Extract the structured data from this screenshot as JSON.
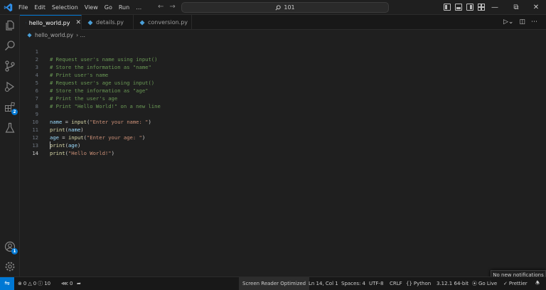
{
  "window": {
    "menu": [
      "File",
      "Edit",
      "Selection",
      "View",
      "Go",
      "Run",
      "…"
    ],
    "search_text": "101",
    "icons": [
      "vscode-logo",
      "back-arrow",
      "forward-arrow",
      "search-icon",
      "layout-icons",
      "minimize",
      "restore",
      "close"
    ]
  },
  "tabs": [
    {
      "label": "hello_world.py",
      "active": true
    },
    {
      "label": "details.py",
      "active": false
    },
    {
      "label": "conversion.py",
      "active": false
    }
  ],
  "breadcrumb": {
    "file": "hello_world.py",
    "more": "› …"
  },
  "activity": {
    "extensions_badge": "2",
    "accounts_badge": "1"
  },
  "editor": {
    "lines": [
      {
        "n": "1",
        "c": "# Request user's name using input()"
      },
      {
        "n": "2",
        "c": "# Store the information as \"name\""
      },
      {
        "n": "3",
        "c": "# Print user's name"
      },
      {
        "n": "4",
        "c": "# Request user's age using input()"
      },
      {
        "n": "5",
        "c": "# Store the information as \"age\""
      },
      {
        "n": "6",
        "c": "# Print the user's age"
      },
      {
        "n": "7",
        "c": "# Print \"Hello World!\" on a new line"
      },
      {
        "n": "8",
        "c": ""
      },
      {
        "n": "9",
        "var": "name",
        "eq": " = ",
        "fn": "input",
        "open": "(",
        "str": "\"Enter your name: \"",
        "close": ")"
      },
      {
        "n": "10",
        "fn": "print",
        "open": "(",
        "var": "name",
        "close": ")"
      },
      {
        "n": "11",
        "var": "age",
        "eq": " = ",
        "fn": "input",
        "open": "(",
        "str": "\"Enter your age: \"",
        "close": ")"
      },
      {
        "n": "12",
        "fn": "print",
        "open": "(",
        "var": "age",
        "close": ")"
      },
      {
        "n": "13",
        "fn": "print",
        "open": "(",
        "str": "\"Hello World!\"",
        "close": ")"
      },
      {
        "n": "14",
        "c": ""
      }
    ]
  },
  "notification": "No new notifications",
  "statusbar": {
    "errors": "0",
    "warnings": "0",
    "info": "10",
    "ports": "0",
    "screen_reader": "Screen Reader Optimized",
    "position": "Ln 14, Col 1",
    "spaces": "Spaces: 4",
    "encoding": "UTF-8",
    "eol": "CRLF",
    "language": "Python",
    "interpreter": "3.12.1 64-bit",
    "golive": "Go Live",
    "prettier": "Prettier"
  },
  "colors": {
    "accent": "#0078d4",
    "comment": "#6a9955",
    "string": "#ce9178",
    "function": "#dcdcaa",
    "variable": "#9cdcfe"
  }
}
